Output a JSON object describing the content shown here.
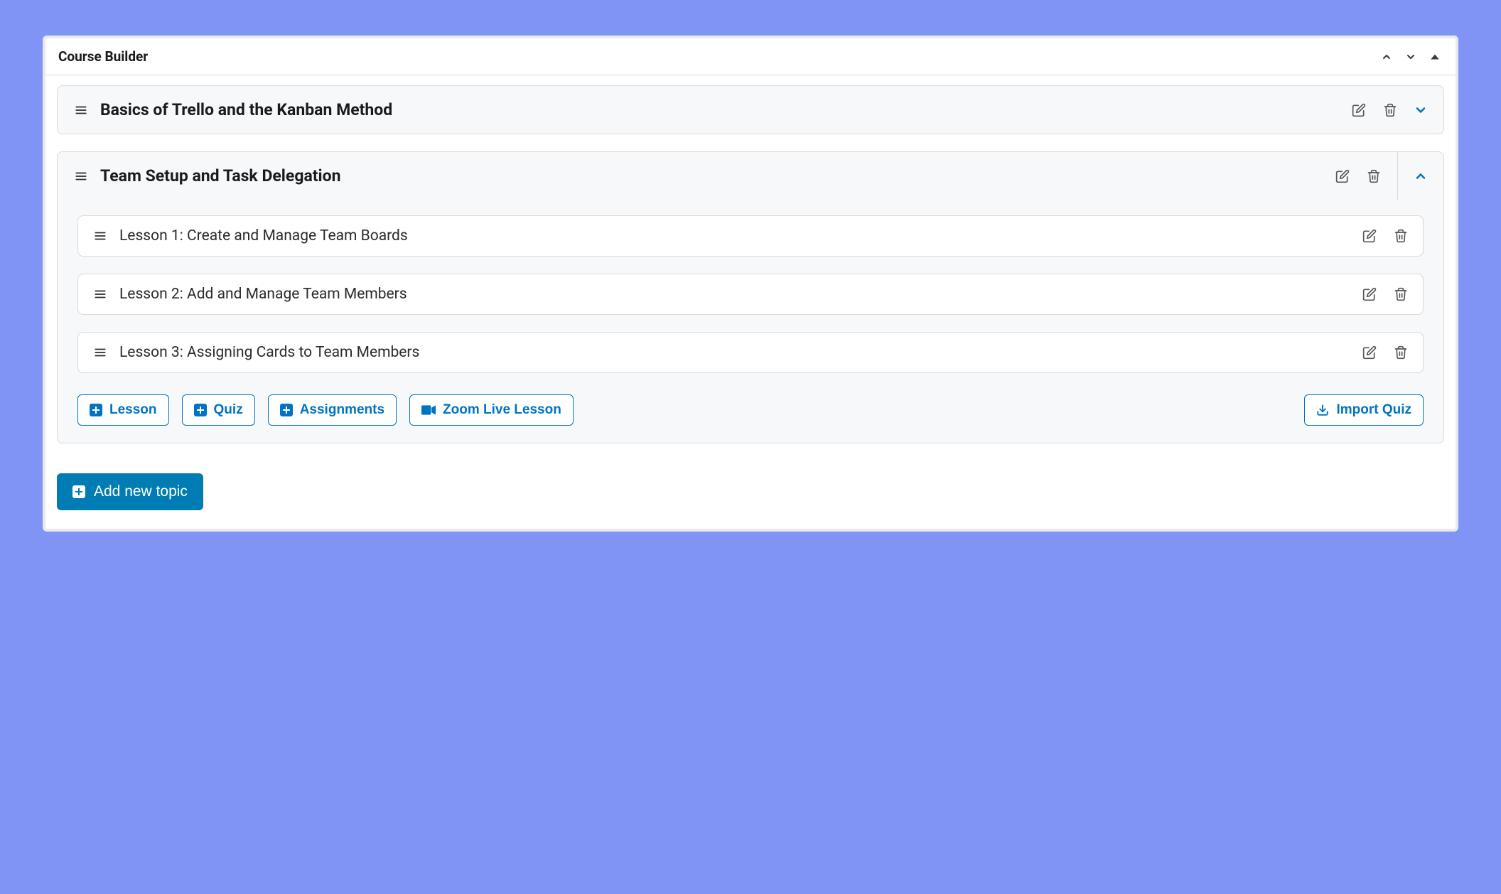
{
  "panel": {
    "title": "Course Builder"
  },
  "topics": [
    {
      "title": "Basics of Trello and the Kanban Method",
      "expanded": false
    },
    {
      "title": "Team Setup and Task Delegation",
      "expanded": true,
      "lessons": [
        {
          "title": "Lesson 1: Create and Manage Team Boards"
        },
        {
          "title": "Lesson 2: Add and Manage Team Members"
        },
        {
          "title": "Lesson 3: Assigning Cards to Team Members"
        }
      ]
    }
  ],
  "buttons": {
    "lesson": "Lesson",
    "quiz": "Quiz",
    "assignments": "Assignments",
    "zoom": "Zoom Live Lesson",
    "import_quiz": "Import Quiz",
    "add_topic": "Add new topic"
  },
  "colors": {
    "accent": "#0073C4",
    "primary_button": "#007CB4",
    "page_bg": "#8094F5"
  }
}
